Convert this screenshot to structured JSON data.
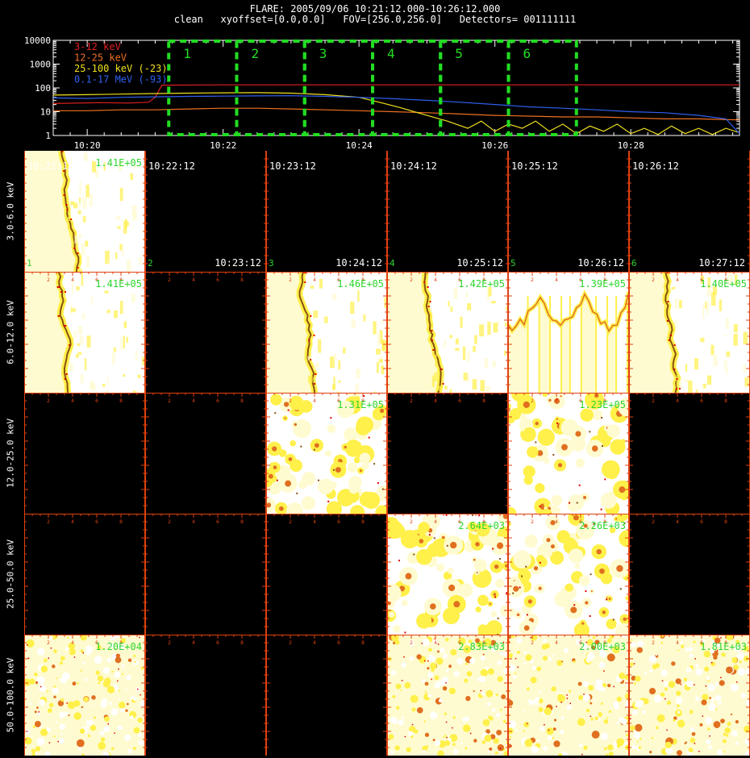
{
  "header": {
    "line1": "FLARE: 2005/09/06 10:21:12.000-10:26:12.000",
    "line2": "clean   xyoffset=[0.0,0.0]   FOV=[256.0,256.0]   Detectors= 001111111"
  },
  "chart_data": [
    {
      "type": "line",
      "ylog": true,
      "ylim": [
        1,
        10000
      ],
      "yticks": [
        "10000",
        "1000",
        "100",
        "10",
        "1"
      ],
      "xlim_min": [
        19.5,
        29.6
      ],
      "xticks": [
        "10:20",
        "10:22",
        "10:24",
        "10:26",
        "10:28"
      ],
      "xtick_min": [
        20,
        22,
        24,
        26,
        28
      ],
      "legend_position": "top-left",
      "series": [
        {
          "name": "3-12 keV",
          "color": "#e02020",
          "t": [
            19.5,
            20.2,
            20.6,
            20.9,
            21.0,
            21.1,
            22,
            23,
            24,
            25,
            26,
            27,
            28,
            29.6
          ],
          "v": [
            22,
            24,
            23,
            25,
            40,
            130,
            135,
            135,
            135,
            135,
            135,
            135,
            135,
            135
          ]
        },
        {
          "name": "12-25 keV",
          "color": "#f07020",
          "t": [
            19.5,
            20.0,
            20.5,
            21.0,
            21.5,
            22.0,
            22.5,
            23.0,
            23.5,
            24.0,
            24.5,
            25.0,
            25.5,
            26.0,
            26.5,
            27.0,
            27.5,
            28.0,
            28.5,
            29.0,
            29.6
          ],
          "v": [
            11,
            11,
            12,
            12,
            13,
            14,
            14,
            13,
            12,
            11,
            10,
            9,
            8,
            7,
            6.5,
            6,
            6,
            5.5,
            5,
            5,
            4.5
          ]
        },
        {
          "name": "25-100 keV (-23)",
          "color": "#f0e020",
          "t": [
            19.5,
            20.0,
            20.5,
            21.0,
            21.5,
            22.0,
            22.5,
            23.0,
            23.5,
            24.0,
            24.3,
            24.6,
            25.0,
            25.3,
            25.6,
            25.8,
            26.0,
            26.2,
            26.4,
            26.6,
            26.8,
            27.0,
            27.2,
            27.4,
            27.6,
            27.8,
            28.0,
            28.2,
            28.4,
            28.6,
            28.8,
            29.0,
            29.2,
            29.4,
            29.6
          ],
          "v": [
            50,
            52,
            55,
            58,
            60,
            62,
            63,
            60,
            52,
            40,
            25,
            15,
            7,
            4,
            2,
            4,
            1.5,
            3,
            2,
            4,
            1.5,
            3,
            1.2,
            2.5,
            1.5,
            3,
            1.2,
            2,
            1.1,
            2.5,
            1.2,
            2,
            1.1,
            2,
            1.3
          ]
        },
        {
          "name": "0.1-17 MeV (-93)",
          "color": "#3060f0",
          "t": [
            19.5,
            20.0,
            20.5,
            21.0,
            21.5,
            22.0,
            22.5,
            23.0,
            23.5,
            24.0,
            24.5,
            25.0,
            25.5,
            26.0,
            26.5,
            27.0,
            27.5,
            28.0,
            28.5,
            29.0,
            29.4,
            29.6
          ],
          "v": [
            38,
            36,
            40,
            42,
            44,
            45,
            46,
            47,
            44,
            40,
            35,
            30,
            25,
            20,
            16,
            14,
            12,
            10,
            9,
            7,
            5,
            1.2
          ]
        }
      ],
      "intervals": [
        {
          "label": "1",
          "start": 21.2,
          "end": 22.2
        },
        {
          "label": "2",
          "start": 22.2,
          "end": 23.2
        },
        {
          "label": "3",
          "start": 23.2,
          "end": 24.2
        },
        {
          "label": "4",
          "start": 24.2,
          "end": 25.2
        },
        {
          "label": "5",
          "start": 25.2,
          "end": 26.2
        },
        {
          "label": "6",
          "start": 26.2,
          "end": 27.2
        }
      ],
      "interval_color": "#22dd22"
    },
    {
      "type": "heatmap",
      "rows": [
        "3.0-6.0 keV",
        "6.0-12.0 keV",
        "12.0-25.0 keV",
        "25.0-50.0 keV",
        "50.0-100.0 keV"
      ],
      "columns": [
        {
          "interval": "1",
          "start": "10:21:12",
          "end": "10:22:12"
        },
        {
          "interval": "2",
          "start": "10:22:12",
          "end": "10:23:12"
        },
        {
          "interval": "3",
          "start": "10:23:12",
          "end": "10:24:12"
        },
        {
          "interval": "4",
          "start": "10:24:12",
          "end": "10:25:12"
        },
        {
          "interval": "5",
          "start": "10:25:12",
          "end": "10:26:12"
        },
        {
          "interval": "6",
          "start": "10:26:12",
          "end": "10:27:12"
        }
      ],
      "peaks": [
        [
          "1.41E+05",
          "",
          "",
          "",
          "",
          ""
        ],
        [
          "1.41E+05",
          "",
          "1.46E+05",
          "1.42E+05",
          "1.39E+05",
          "1.40E+05"
        ],
        [
          "",
          "",
          "1.31E+05",
          "",
          "1.23E+05",
          ""
        ],
        [
          "",
          "",
          "",
          "2.64E+03",
          "2.26E+03",
          ""
        ],
        [
          "1.20E+04",
          "",
          "",
          "2.83E+03",
          "2.00E+03",
          "1.81E+03"
        ]
      ],
      "patterns": [
        [
          "edge",
          "empty",
          "empty",
          "empty",
          "empty",
          "empty"
        ],
        [
          "edge",
          "empty",
          "edge",
          "edge",
          "fingers",
          "edge"
        ],
        [
          "empty",
          "empty",
          "blotch",
          "empty",
          "blotch",
          "empty"
        ],
        [
          "empty",
          "empty",
          "empty",
          "blotch",
          "blotch",
          "empty"
        ],
        [
          "speckle",
          "empty",
          "empty",
          "speckle",
          "speckle",
          "speckle"
        ]
      ],
      "axis_ticks": [
        "2",
        "4",
        "6",
        "8"
      ],
      "axis_color": "#e04010",
      "colors": {
        "white": "#ffffff",
        "pale": "#fffbd0",
        "yellow": "#fff04a",
        "orange": "#e07020",
        "brown": "#8a5010",
        "red": "#e00000"
      }
    }
  ]
}
